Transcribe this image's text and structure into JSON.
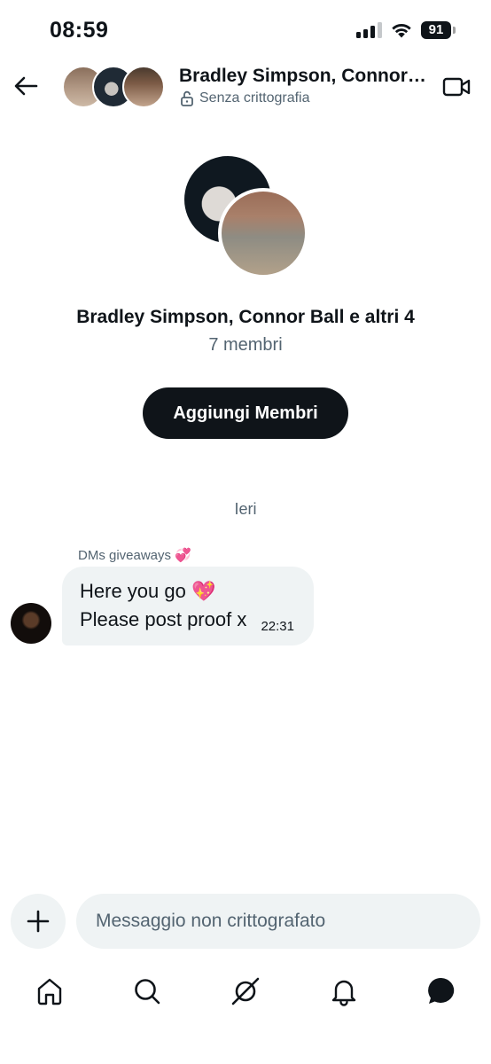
{
  "status_bar": {
    "time": "08:59",
    "battery": "91"
  },
  "header": {
    "title": "Bradley Simpson, Connor…",
    "encryption_status": "Senza crittografia"
  },
  "group": {
    "name": "Bradley Simpson, Connor Ball e altri 4",
    "members": "7 membri",
    "add_members_label": "Aggiungi Membri"
  },
  "conversation": {
    "day_label": "Ieri",
    "messages": [
      {
        "sender": "DMs giveaways 💞",
        "lines": [
          "Here you go 💖",
          "Please post proof x"
        ],
        "time": "22:31"
      }
    ]
  },
  "composer": {
    "placeholder": "Messaggio non crittografato"
  },
  "nav": [
    "home-icon",
    "search-icon",
    "grok-icon",
    "notifications-icon",
    "messages-icon"
  ],
  "colors": {
    "text": "#0f1419",
    "secondary": "#536471",
    "bubble": "#eff3f4",
    "button": "#0f1419"
  }
}
